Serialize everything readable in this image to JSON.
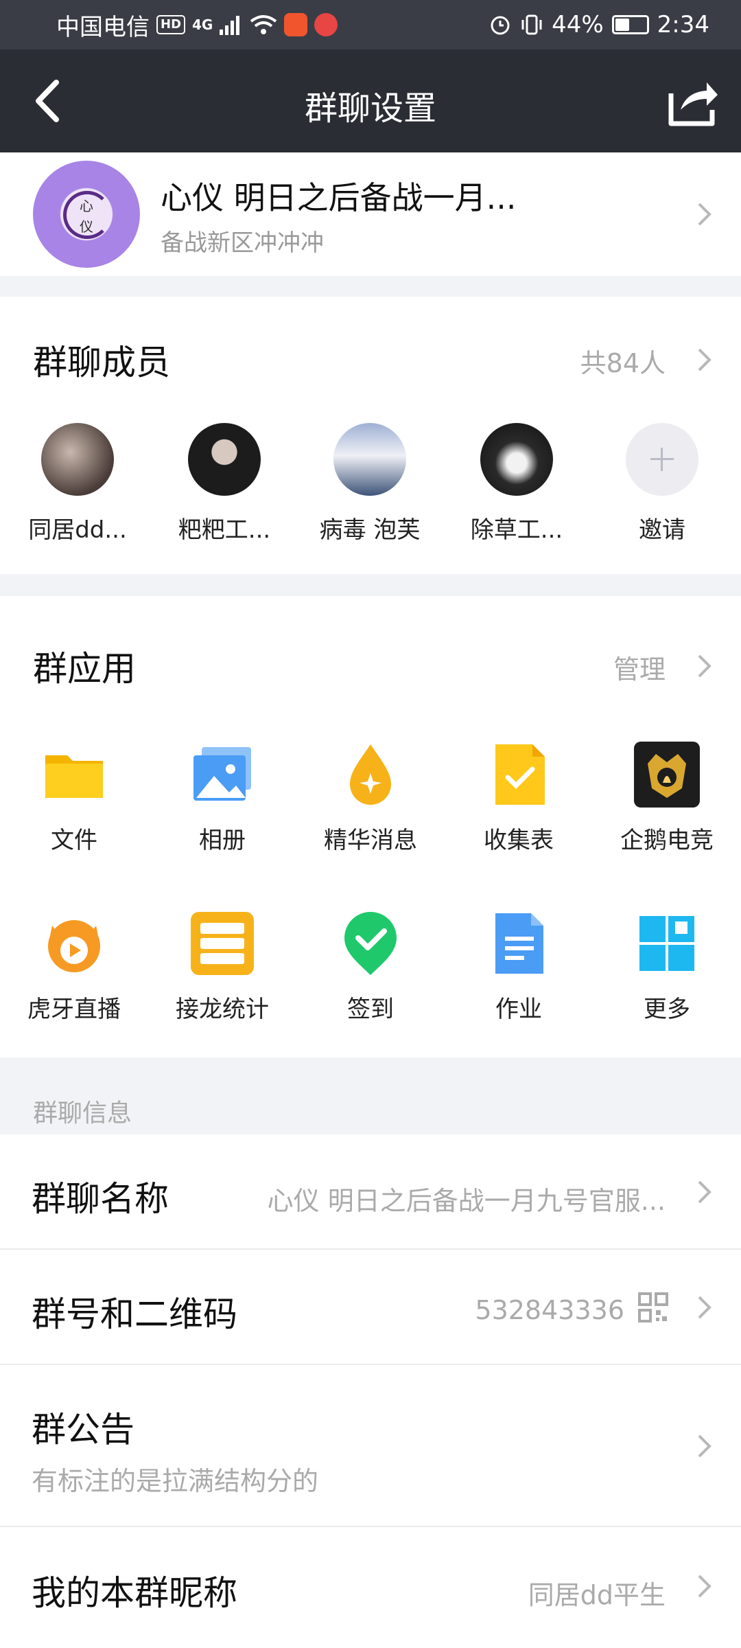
{
  "status_bar": {
    "carrier": "中国电信",
    "hd": "HD",
    "network": "4G",
    "battery": "44%",
    "time": "2:34"
  },
  "nav": {
    "title": "群聊设置"
  },
  "group": {
    "name": "心仪 明日之后备战一月...",
    "subtitle": "备战新区冲冲冲",
    "avatar_text_1": "心",
    "avatar_text_2": "仪"
  },
  "members": {
    "title": "群聊成员",
    "count": "共84人",
    "list": [
      {
        "name": "同居dd..."
      },
      {
        "name": "粑粑工..."
      },
      {
        "name": "病毒  泡芙"
      },
      {
        "name": "除草工..."
      }
    ],
    "invite_label": "邀请"
  },
  "apps": {
    "title": "群应用",
    "manage": "管理",
    "items": [
      {
        "label": "文件",
        "icon": "folder-icon"
      },
      {
        "label": "相册",
        "icon": "photo-album-icon"
      },
      {
        "label": "精华消息",
        "icon": "essence-drop-icon"
      },
      {
        "label": "收集表",
        "icon": "form-check-icon"
      },
      {
        "label": "企鹅电竞",
        "icon": "penguin-esports-icon"
      },
      {
        "label": "虎牙直播",
        "icon": "huya-live-icon"
      },
      {
        "label": "接龙统计",
        "icon": "list-stats-icon"
      },
      {
        "label": "签到",
        "icon": "checkin-icon"
      },
      {
        "label": "作业",
        "icon": "homework-doc-icon"
      },
      {
        "label": "更多",
        "icon": "more-grid-icon"
      }
    ]
  },
  "info": {
    "section_label": "群聊信息",
    "name_row": {
      "title": "群聊名称",
      "value": "心仪 明日之后备战一月九号官服..."
    },
    "number_row": {
      "title": "群号和二维码",
      "value": "532843336"
    },
    "notice_row": {
      "title": "群公告",
      "subtitle": "有标注的是拉满结构分的"
    },
    "nickname_row": {
      "title": "我的本群昵称",
      "value": "同居dd平生"
    }
  },
  "colors": {
    "nav_bg": "#2a2d33",
    "status_bg": "#3a3d45",
    "page_bg": "#f2f3f6",
    "secondary_text": "#aaaaaa",
    "accent_blue": "#3a8cf0"
  }
}
